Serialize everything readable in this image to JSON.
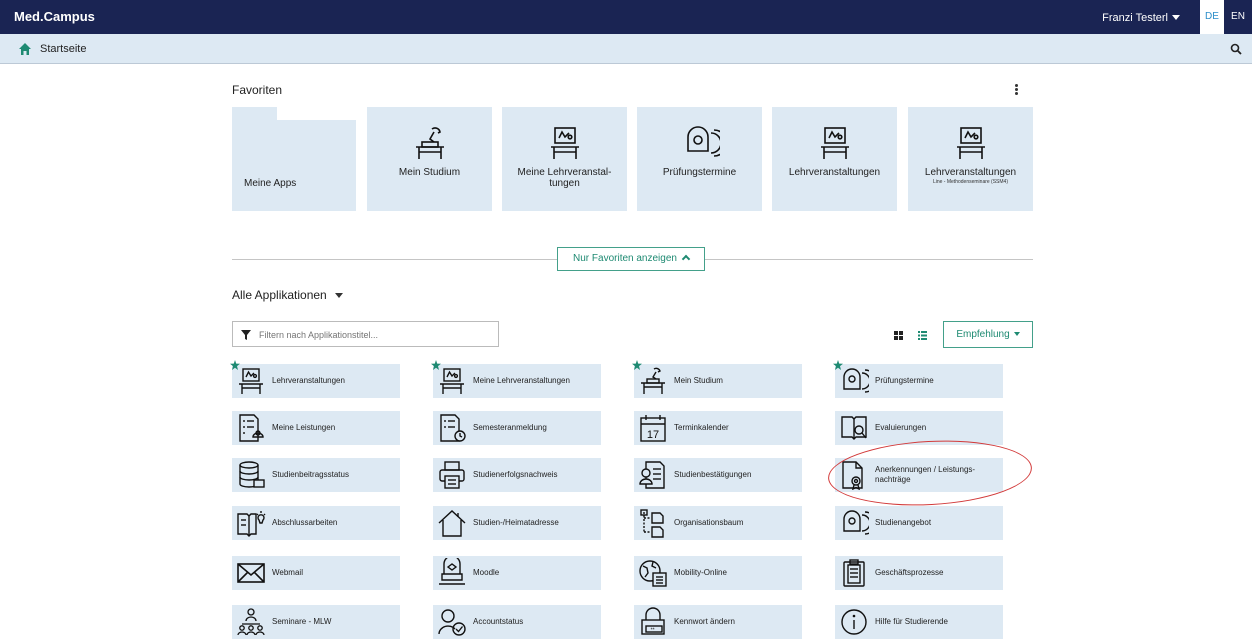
{
  "topbar": {
    "brand": "Med.Campus",
    "user": "Franzi Testerl",
    "lang_de": "DE",
    "lang_en": "EN"
  },
  "subbar": {
    "title": "Startseite"
  },
  "favorites": {
    "title": "Favoriten",
    "tiles": [
      {
        "label": "Meine Apps",
        "sub": "",
        "icon": "folder-icon"
      },
      {
        "label": "Mein Studium",
        "sub": "",
        "icon": "desk-lamp-icon"
      },
      {
        "label": "Meine Lehrveranstal-tungen",
        "sub": "",
        "icon": "lecture-board-icon"
      },
      {
        "label": "Prüfungstermine",
        "sub": "",
        "icon": "exam-head-icon"
      },
      {
        "label": "Lehrveranstaltungen",
        "sub": "",
        "icon": "lecture-board-icon"
      },
      {
        "label": "Lehrveranstaltungen",
        "sub": "Line - Methodenseminare (SSM4)",
        "icon": "lecture-board-icon"
      }
    ]
  },
  "toggle": {
    "label": "Nur Favoriten anzeigen"
  },
  "all_apps": {
    "title": "Alle Applikationen",
    "filter_placeholder": "Filtern nach Applikationstitel...",
    "sort_label": "Empfehlung",
    "items": [
      {
        "label": "Lehrveranstaltungen",
        "icon": "lecture-board-icon",
        "fav": true
      },
      {
        "label": "Meine Lehrveranstaltungen",
        "icon": "lecture-board-icon",
        "fav": true
      },
      {
        "label": "Mein Studium",
        "icon": "desk-lamp-icon",
        "fav": true
      },
      {
        "label": "Prüfungstermine",
        "icon": "exam-head-icon",
        "fav": true
      },
      {
        "label": "Meine Leistungen",
        "icon": "document-list-icon",
        "fav": false
      },
      {
        "label": "Semesteranmeldung",
        "icon": "document-clock-icon",
        "fav": false
      },
      {
        "label": "Terminkalender",
        "icon": "calendar-icon",
        "fav": false
      },
      {
        "label": "Evaluierungen",
        "icon": "book-search-icon",
        "fav": false
      },
      {
        "label": "Studienbeitragsstatus",
        "icon": "database-icon",
        "fav": false
      },
      {
        "label": "Studienerfolgsnachweis",
        "icon": "printer-icon",
        "fav": false
      },
      {
        "label": "Studienbestätigungen",
        "icon": "certificate-icon",
        "fav": false
      },
      {
        "label": "Anerkennungen / Leistungs-nachträge",
        "icon": "document-seal-icon",
        "fav": false
      },
      {
        "label": "Abschlussarbeiten",
        "icon": "thesis-bulb-icon",
        "fav": false
      },
      {
        "label": "Studien-/Heimatadresse",
        "icon": "house-icon",
        "fav": false
      },
      {
        "label": "Organisationsbaum",
        "icon": "org-tree-icon",
        "fav": false
      },
      {
        "label": "Studienangebot",
        "icon": "exam-head-icon",
        "fav": false
      },
      {
        "label": "Webmail",
        "icon": "envelope-icon",
        "fav": false
      },
      {
        "label": "Moodle",
        "icon": "moodle-hat-icon",
        "fav": false
      },
      {
        "label": "Mobility-Online",
        "icon": "globe-book-icon",
        "fav": false
      },
      {
        "label": "Geschäftsprozesse",
        "icon": "clipboard-icon",
        "fav": false
      },
      {
        "label": "Seminare - MLW",
        "icon": "people-group-icon",
        "fav": false
      },
      {
        "label": "Accountstatus",
        "icon": "user-check-icon",
        "fav": false
      },
      {
        "label": "Kennwort ändern",
        "icon": "lock-password-icon",
        "fav": false
      },
      {
        "label": "Hilfe für Studierende",
        "icon": "info-circle-icon",
        "fav": false
      }
    ]
  },
  "colors": {
    "navy": "#1a2453",
    "tile": "#dde9f3",
    "accent": "#1e8a72",
    "star": "#1e8a72",
    "annotation": "#d23a3a"
  }
}
